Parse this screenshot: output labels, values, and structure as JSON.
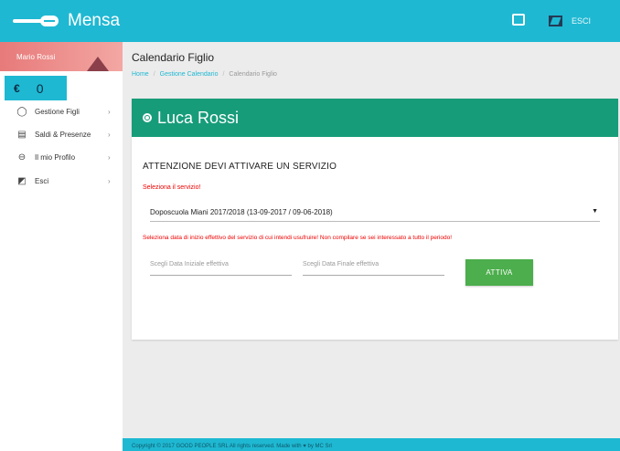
{
  "app": {
    "title": "Mensa",
    "exit_label": "ESCI"
  },
  "sidebar": {
    "user_name": "Mario Rossi",
    "balance": {
      "currency": "€",
      "value": "0"
    },
    "items": [
      {
        "label": "Gestione Figli",
        "icon": "child-icon"
      },
      {
        "label": "Saldi & Presenze",
        "icon": "document-icon"
      },
      {
        "label": "Il mio Profilo",
        "icon": "user-icon"
      },
      {
        "label": "Esci",
        "icon": "exit-icon"
      }
    ]
  },
  "page": {
    "title": "Calendario Figlio",
    "breadcrumb": [
      "Home",
      "Gestione Calendario",
      "Calendario Figlio"
    ]
  },
  "card": {
    "child_name": "Luca Rossi",
    "warning_title": "ATTENZIONE DEVI ATTIVARE UN SERVIZIO",
    "select_label": "Seleziona il servizio!",
    "selected_service": "Doposcuola Miani 2017/2018 (13-09-2017 / 09-06-2018)",
    "date_note": "Seleziona data di inizio effettivo del servizio di cui intendi usufruire! Non compilare se sei interessato a tutto il periodo!",
    "start_placeholder": "Scegli Data Iniziale effettiva",
    "end_placeholder": "Scegli Data Finale effettiva",
    "activate_label": "ATTIVA"
  },
  "footer": {
    "text": "Copyright © 2017 GOOD PEOPLE SRL All rights reserved. Made with ♥ by MC Srl"
  },
  "colors": {
    "topbar": "#1fb8d2",
    "card_header": "#179c7a",
    "button": "#4cae4c",
    "warning": "#e00000"
  }
}
